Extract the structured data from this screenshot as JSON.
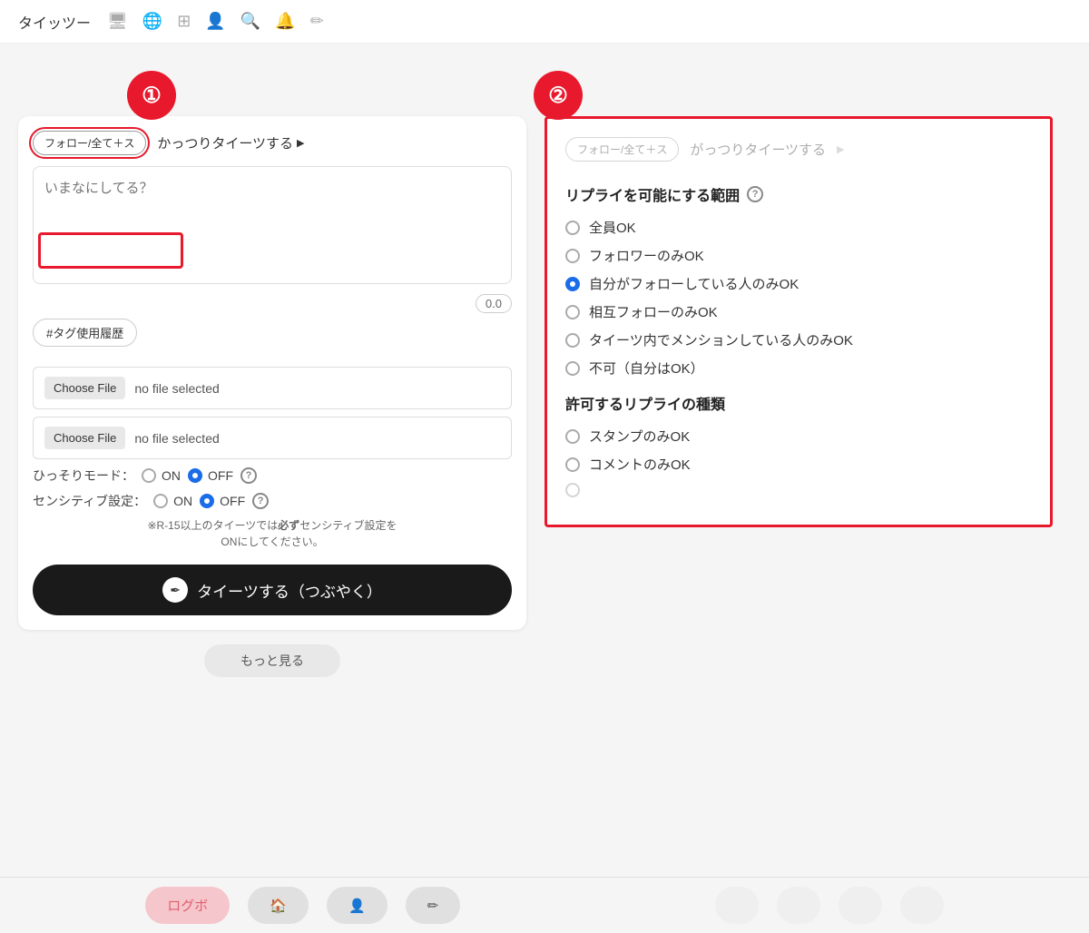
{
  "nav": {
    "logo": "タイッツー",
    "icons": [
      "🖥",
      "🌐",
      "⊞",
      "👤",
      "🔍",
      "🔔",
      "✏"
    ]
  },
  "left_panel": {
    "follow_button": "フォロー/全て＋ス",
    "gattsuri_link": "かっつりタイーツする",
    "tweet_placeholder": "いまなにしてる？",
    "char_count": "0.0",
    "tag_history": "#タグ使用履歴",
    "file_input_1": {
      "button": "Choose File",
      "label": "no file selected"
    },
    "file_input_2": {
      "button": "Choose File",
      "label": "no file selected"
    },
    "hissori_mode": {
      "label": "ひっそりモード：",
      "on": "ON",
      "off": "OFF"
    },
    "sensitive_setting": {
      "label": "センシティブ設定：",
      "on": "ON",
      "off": "OFF"
    },
    "note": "※R-15以上のタイーツでは必ずセンシティブ設定をONにしてください。",
    "tweet_button": "タイーツする（つぶやく）"
  },
  "right_panel": {
    "follow_button": "フォロー/全て＋ス",
    "gattsuri_link": "がっつりタイーツする",
    "reply_section_title": "リプライを可能にする範囲",
    "reply_options": [
      {
        "label": "全員OK",
        "selected": false
      },
      {
        "label": "フォロワーのみOK",
        "selected": false
      },
      {
        "label": "自分がフォローしている人のみOK",
        "selected": true
      },
      {
        "label": "相互フォローのみOK",
        "selected": false
      },
      {
        "label": "タイーツ内でメンションしている人のみOK",
        "selected": false
      },
      {
        "label": "不可（自分はOK）",
        "selected": false
      }
    ],
    "reply_type_title": "許可するリプライの種類",
    "reply_type_options": [
      {
        "label": "スタンプのみOK",
        "selected": false
      },
      {
        "label": "コメントのみOK",
        "selected": false
      }
    ]
  },
  "bottom_nav": {
    "login_bonus": "ログボ",
    "home": "🏠",
    "profile": "👤",
    "edit": "✏"
  },
  "annotations": {
    "circle1": "①",
    "circle2": "②"
  }
}
